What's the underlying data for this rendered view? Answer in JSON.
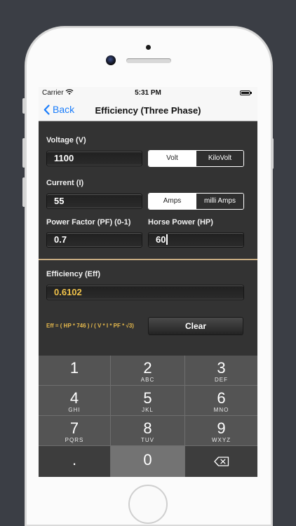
{
  "status_bar": {
    "carrier": "Carrier",
    "time": "5:31 PM"
  },
  "nav": {
    "back_label": "Back",
    "title": "Efficiency (Three Phase)"
  },
  "voltage": {
    "label": "Voltage (V)",
    "value": "1100",
    "units": [
      "Volt",
      "KiloVolt"
    ],
    "selected_unit": "Volt"
  },
  "current": {
    "label": "Current (I)",
    "value": "55",
    "units": [
      "Amps",
      "milli Amps"
    ],
    "selected_unit": "Amps"
  },
  "power_factor": {
    "label": "Power Factor (PF) (0-1)",
    "value": "0.7"
  },
  "horse_power": {
    "label": "Horse Power (HP)",
    "value": "60"
  },
  "efficiency": {
    "label": "Efficiency (Eff)",
    "value": "0.6102"
  },
  "formula": "Eff = ( HP * 746 ) / ( V * I * PF * √3)",
  "clear_label": "Clear",
  "keypad": {
    "keys": [
      {
        "num": "1",
        "letters": ""
      },
      {
        "num": "2",
        "letters": "ABC"
      },
      {
        "num": "3",
        "letters": "DEF"
      },
      {
        "num": "4",
        "letters": "GHI"
      },
      {
        "num": "5",
        "letters": "JKL"
      },
      {
        "num": "6",
        "letters": "MNO"
      },
      {
        "num": "7",
        "letters": "PQRS"
      },
      {
        "num": "8",
        "letters": "TUV"
      },
      {
        "num": "9",
        "letters": "WXYZ"
      }
    ],
    "decimal": ".",
    "zero": "0",
    "delete_icon": "backspace-icon"
  },
  "colors": {
    "accent_blue": "#1a7dfb",
    "result_gold": "#f0c24a",
    "divider": "#c9ad82",
    "screen_bg": "#333333"
  }
}
